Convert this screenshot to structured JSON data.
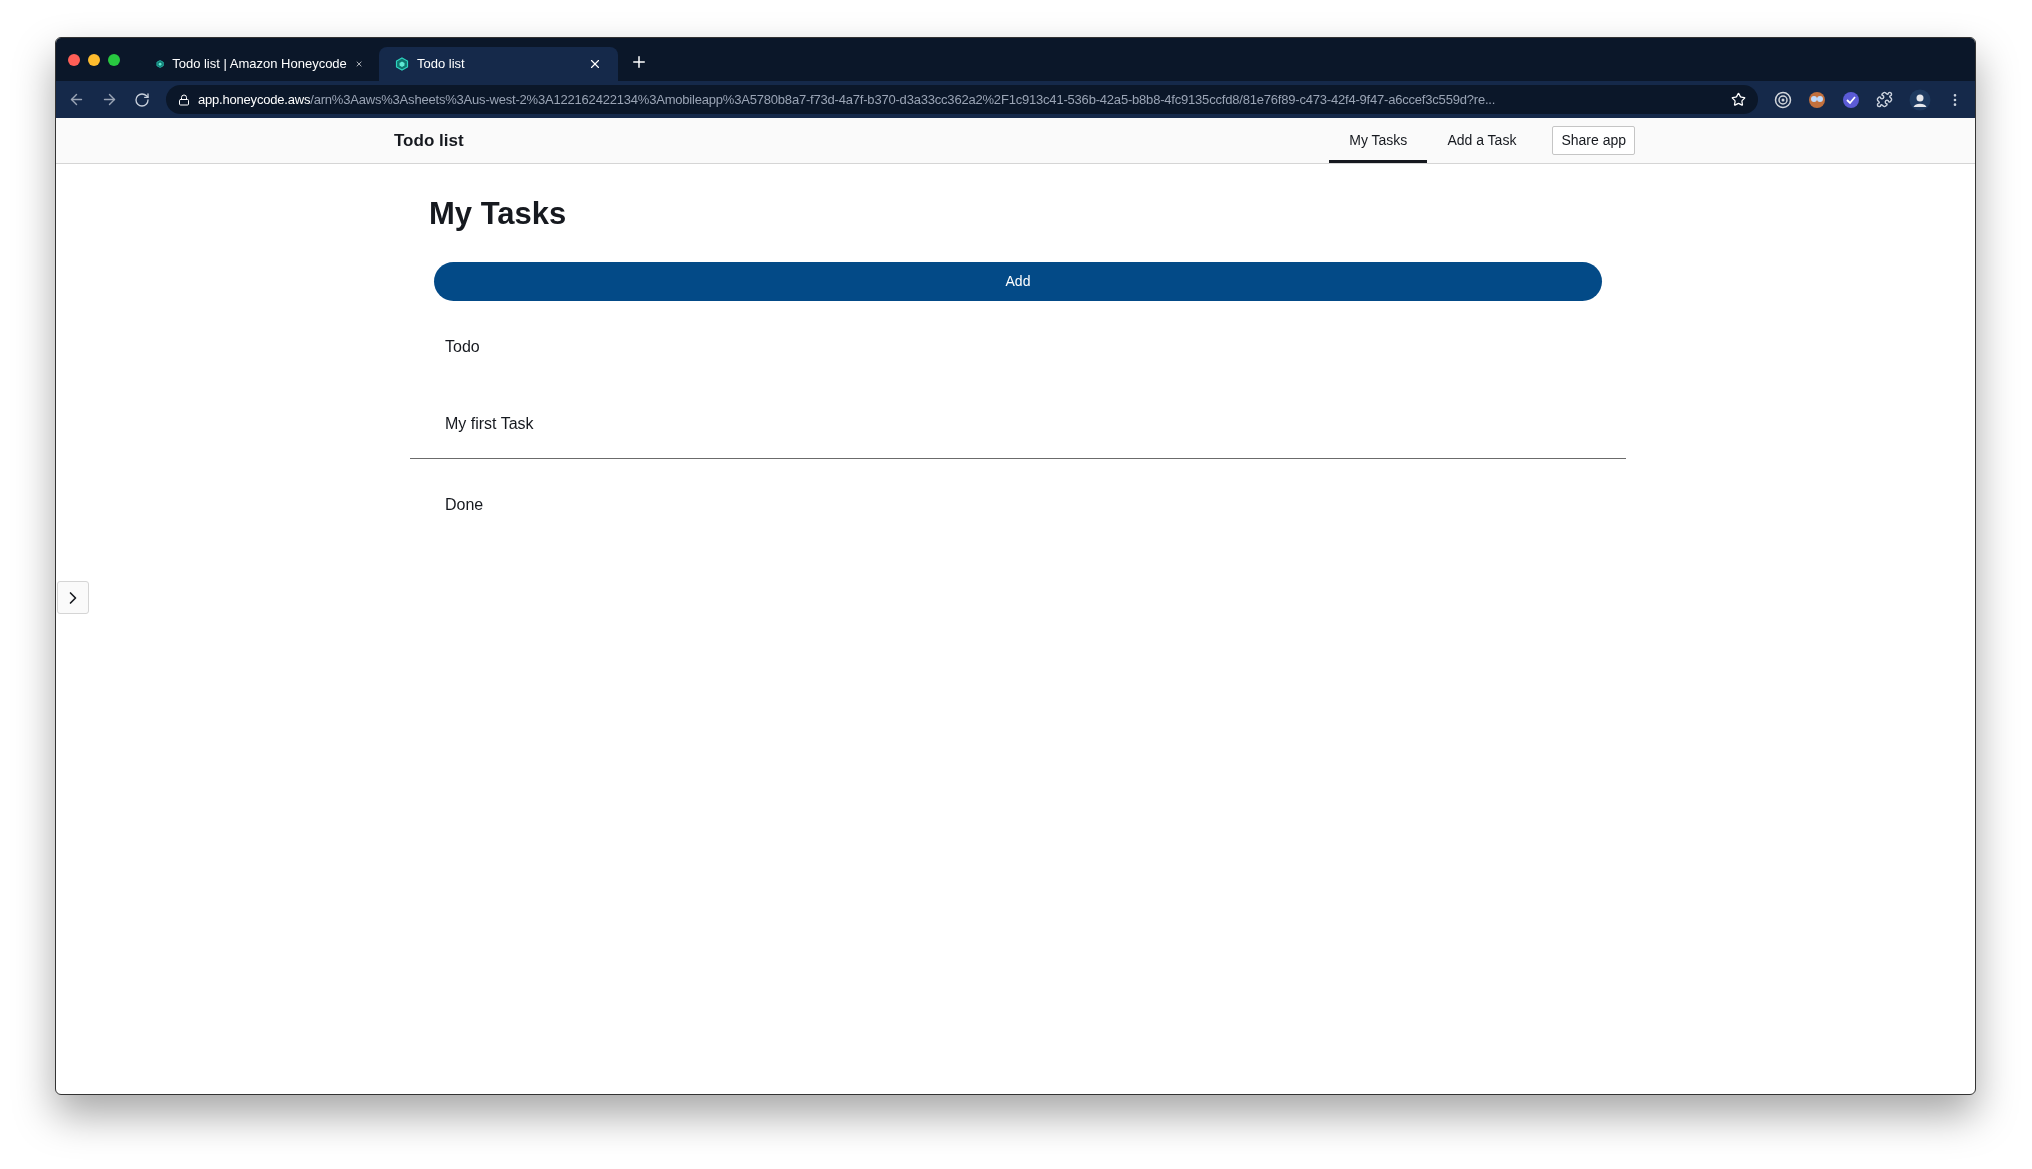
{
  "browser": {
    "tabs": [
      {
        "title": "Todo list | Amazon Honeycode",
        "selected": false
      },
      {
        "title": "Todo list",
        "selected": true
      }
    ],
    "url": {
      "host": "app.honeycode.aws",
      "path": "/arn%3Aaws%3Asheets%3Aus-west-2%3A122162422134%3Amobileapp%3A5780b8a7-f73d-4a7f-b370-d3a33cc362a2%2F1c913c41-536b-42a5-b8b8-4fc9135ccfd8/81e76f89-c473-42f4-9f47-a6ccef3c559d?re..."
    }
  },
  "app_bar": {
    "title": "Todo list",
    "nav": [
      {
        "label": "My Tasks",
        "selected": true
      },
      {
        "label": "Add a Task",
        "selected": false
      }
    ],
    "share_button": "Share app"
  },
  "page": {
    "title": "My Tasks",
    "add_button": "Add",
    "groups": [
      {
        "title": "Todo",
        "tasks": [
          "My first Task"
        ]
      },
      {
        "title": "Done"
      }
    ]
  }
}
